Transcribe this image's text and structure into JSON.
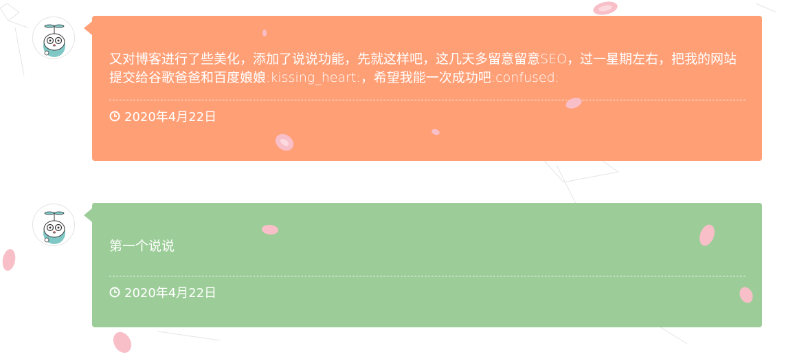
{
  "posts": [
    {
      "text": "又对博客进行了些美化，添加了说说功能，先就这样吧，这几天多留意留意SEO，过一星期左右，把我的网站提交给谷歌爸爸和百度娘娘:kissing_heart:，希望我能一次成功吧:confused:",
      "date": "2020年4月22日",
      "accent": "#ff9f76"
    },
    {
      "text": "第一个说说",
      "date": "2020年4月22日",
      "accent": "#9ccd98"
    }
  ],
  "icons": {
    "avatar": "cat-avatar-icon",
    "date": "clock-icon",
    "decoration": "sakura-petal-icon"
  },
  "colors": {
    "petal": "#f8bfc8",
    "card_text": "#ffffff"
  }
}
